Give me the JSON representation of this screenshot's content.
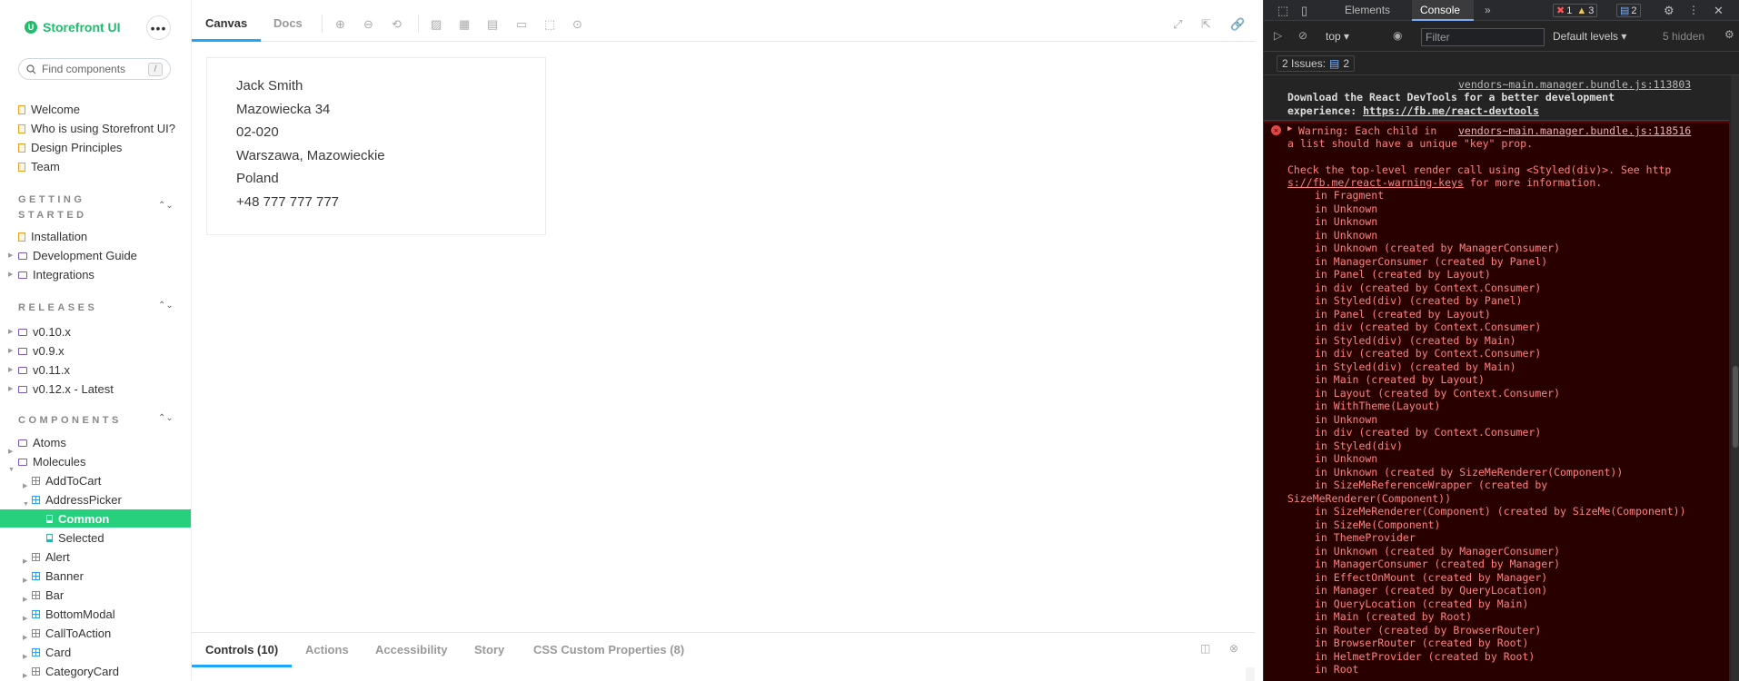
{
  "sidebar": {
    "brand": "Storefront UI",
    "search_placeholder": "Find components",
    "search_shortcut": "/",
    "docs": [
      "Welcome",
      "Who is using Storefront UI?",
      "Design Principles",
      "Team"
    ],
    "getting_started_title_1": "GETTING",
    "getting_started_title_2": "STARTED",
    "getting_started": [
      {
        "label": "Installation",
        "kind": "doc"
      },
      {
        "label": "Development Guide",
        "kind": "folder"
      },
      {
        "label": "Integrations",
        "kind": "folder"
      }
    ],
    "releases_title": "RELEASES",
    "releases": [
      "v0.10.x",
      "v0.9.x",
      "v0.11.x",
      "v0.12.x - Latest"
    ],
    "components_title": "COMPONENTS",
    "components_top": [
      "Atoms",
      "Molecules"
    ],
    "molecules": [
      "AddToCart",
      "AddressPicker"
    ],
    "stories": [
      "Common",
      "Selected"
    ],
    "molecules_more": [
      "Alert",
      "Banner",
      "Bar",
      "BottomModal",
      "CallToAction",
      "Card",
      "CategoryCard"
    ]
  },
  "main": {
    "tabs": [
      "Canvas",
      "Docs"
    ],
    "address": [
      "Jack Smith",
      "Mazowiecka 34",
      "02-020",
      "Warszawa, Mazowieckie",
      "Poland",
      "+48 777 777 777"
    ],
    "addon_tabs": [
      "Controls (10)",
      "Actions",
      "Accessibility",
      "Story",
      "CSS Custom Properties (8)"
    ]
  },
  "devtools": {
    "tabs": [
      "Elements",
      "Console"
    ],
    "errors": "1",
    "warnings": "3",
    "messages": "2",
    "context": "top",
    "filter_placeholder": "Filter",
    "levels": "Default levels",
    "hidden": "5 hidden",
    "issues_label": "2 Issues:",
    "issues_count": "2",
    "info_source": "vendors~main.manager.bundle.js:113803",
    "info_text_1": "Download the React DevTools for a better development",
    "info_text_2_prefix": "experience: ",
    "info_link": "https://fb.me/react-devtools",
    "warn_prefix": "Warning: Each child in",
    "warn_source": "vendors~main.manager.bundle.js:118516",
    "warn_line2": "a list should have a unique \"key\" prop.",
    "check_line_1": "Check the top-level render call using <Styled(div)>. See http",
    "check_link_2": "s://fb.me/react-warning-keys",
    "check_line_2_suffix": " for more information.",
    "stack": [
      "in Fragment",
      "in Unknown",
      "in Unknown",
      "in Unknown",
      "in Unknown (created by ManagerConsumer)",
      "in ManagerConsumer (created by Panel)",
      "in Panel (created by Layout)",
      "in div (created by Context.Consumer)",
      "in Styled(div) (created by Panel)",
      "in Panel (created by Layout)",
      "in div (created by Context.Consumer)",
      "in Styled(div) (created by Main)",
      "in div (created by Context.Consumer)",
      "in Styled(div) (created by Main)",
      "in Main (created by Layout)",
      "in Layout (created by Context.Consumer)",
      "in WithTheme(Layout)",
      "in Unknown",
      "in div (created by Context.Consumer)",
      "in Styled(div)",
      "in Unknown",
      "in Unknown (created by SizeMeRenderer(Component))",
      "in SizeMeReferenceWrapper (created by",
      "SizeMeRenderer(Component))",
      "in SizeMeRenderer(Component) (created by SizeMe(Component))",
      "in SizeMe(Component)",
      "in ThemeProvider",
      "in Unknown (created by ManagerConsumer)",
      "in ManagerConsumer (created by Manager)",
      "in EffectOnMount (created by Manager)",
      "in Manager (created by QueryLocation)",
      "in QueryLocation (created by Main)",
      "in Main (created by Root)",
      "in Router (created by BrowserRouter)",
      "in BrowserRouter (created by Root)",
      "in HelmetProvider (created by Root)",
      "in Root"
    ]
  }
}
